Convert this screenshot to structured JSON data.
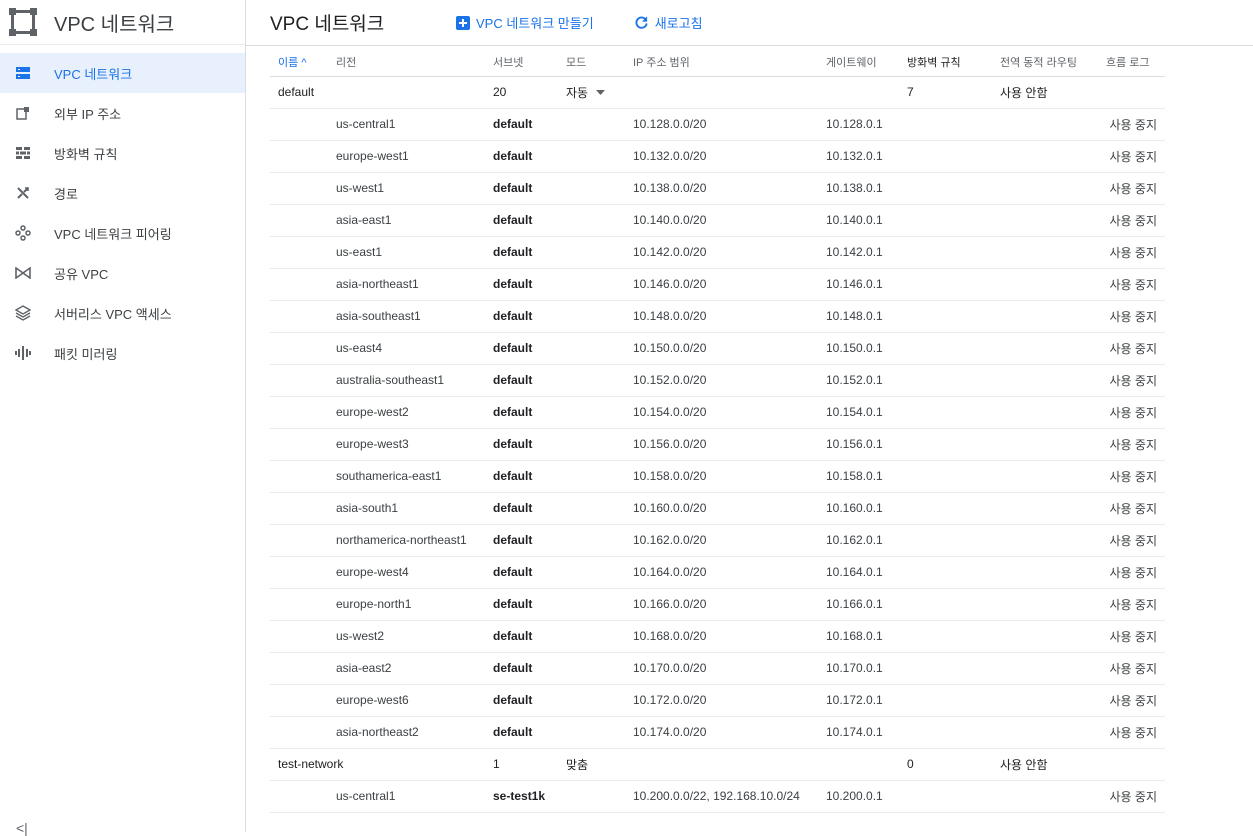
{
  "sidebar": {
    "title": "VPC 네트워크",
    "items": [
      {
        "label": "VPC 네트워크",
        "icon": "vpc-network-icon"
      },
      {
        "label": "외부 IP 주소",
        "icon": "external-ip-icon"
      },
      {
        "label": "방화벽 규칙",
        "icon": "firewall-icon"
      },
      {
        "label": "경로",
        "icon": "routes-icon"
      },
      {
        "label": "VPC 네트워크 피어링",
        "icon": "peering-icon"
      },
      {
        "label": "공유 VPC",
        "icon": "shared-vpc-icon"
      },
      {
        "label": "서버리스 VPC 액세스",
        "icon": "serverless-icon"
      },
      {
        "label": "패킷 미러링",
        "icon": "packet-mirroring-icon"
      }
    ],
    "collapse_label": "<|"
  },
  "header": {
    "title": "VPC 네트워크",
    "create_label": "VPC 네트워크 만들기",
    "refresh_label": "새로고침"
  },
  "table": {
    "columns": {
      "name": "이름",
      "region": "리전",
      "subnets": "서브넷",
      "mode": "모드",
      "ip_range": "IP 주소 범위",
      "gateway": "게이트웨이",
      "firewall": "방화벽 규칙",
      "routing": "전역 동적 라우팅",
      "flow_logs": "흐름 로그"
    },
    "sort_arrow": "^",
    "networks": [
      {
        "name": "default",
        "subnets": "20",
        "mode": "자동",
        "firewall": "7",
        "routing": "사용 안함",
        "rows": [
          {
            "region": "us-central1",
            "subnet": "default",
            "ip": "10.128.0.0/20",
            "gw": "10.128.0.1",
            "flow": "사용 중지"
          },
          {
            "region": "europe-west1",
            "subnet": "default",
            "ip": "10.132.0.0/20",
            "gw": "10.132.0.1",
            "flow": "사용 중지"
          },
          {
            "region": "us-west1",
            "subnet": "default",
            "ip": "10.138.0.0/20",
            "gw": "10.138.0.1",
            "flow": "사용 중지"
          },
          {
            "region": "asia-east1",
            "subnet": "default",
            "ip": "10.140.0.0/20",
            "gw": "10.140.0.1",
            "flow": "사용 중지"
          },
          {
            "region": "us-east1",
            "subnet": "default",
            "ip": "10.142.0.0/20",
            "gw": "10.142.0.1",
            "flow": "사용 중지"
          },
          {
            "region": "asia-northeast1",
            "subnet": "default",
            "ip": "10.146.0.0/20",
            "gw": "10.146.0.1",
            "flow": "사용 중지"
          },
          {
            "region": "asia-southeast1",
            "subnet": "default",
            "ip": "10.148.0.0/20",
            "gw": "10.148.0.1",
            "flow": "사용 중지"
          },
          {
            "region": "us-east4",
            "subnet": "default",
            "ip": "10.150.0.0/20",
            "gw": "10.150.0.1",
            "flow": "사용 중지"
          },
          {
            "region": "australia-southeast1",
            "subnet": "default",
            "ip": "10.152.0.0/20",
            "gw": "10.152.0.1",
            "flow": "사용 중지"
          },
          {
            "region": "europe-west2",
            "subnet": "default",
            "ip": "10.154.0.0/20",
            "gw": "10.154.0.1",
            "flow": "사용 중지"
          },
          {
            "region": "europe-west3",
            "subnet": "default",
            "ip": "10.156.0.0/20",
            "gw": "10.156.0.1",
            "flow": "사용 중지"
          },
          {
            "region": "southamerica-east1",
            "subnet": "default",
            "ip": "10.158.0.0/20",
            "gw": "10.158.0.1",
            "flow": "사용 중지"
          },
          {
            "region": "asia-south1",
            "subnet": "default",
            "ip": "10.160.0.0/20",
            "gw": "10.160.0.1",
            "flow": "사용 중지"
          },
          {
            "region": "northamerica-northeast1",
            "subnet": "default",
            "ip": "10.162.0.0/20",
            "gw": "10.162.0.1",
            "flow": "사용 중지"
          },
          {
            "region": "europe-west4",
            "subnet": "default",
            "ip": "10.164.0.0/20",
            "gw": "10.164.0.1",
            "flow": "사용 중지"
          },
          {
            "region": "europe-north1",
            "subnet": "default",
            "ip": "10.166.0.0/20",
            "gw": "10.166.0.1",
            "flow": "사용 중지"
          },
          {
            "region": "us-west2",
            "subnet": "default",
            "ip": "10.168.0.0/20",
            "gw": "10.168.0.1",
            "flow": "사용 중지"
          },
          {
            "region": "asia-east2",
            "subnet": "default",
            "ip": "10.170.0.0/20",
            "gw": "10.170.0.1",
            "flow": "사용 중지"
          },
          {
            "region": "europe-west6",
            "subnet": "default",
            "ip": "10.172.0.0/20",
            "gw": "10.172.0.1",
            "flow": "사용 중지"
          },
          {
            "region": "asia-northeast2",
            "subnet": "default",
            "ip": "10.174.0.0/20",
            "gw": "10.174.0.1",
            "flow": "사용 중지"
          }
        ]
      },
      {
        "name": "test-network",
        "subnets": "1",
        "mode": "맞춤",
        "firewall": "0",
        "routing": "사용 안함",
        "rows": [
          {
            "region": "us-central1",
            "subnet": "se-test1k",
            "ip": "10.200.0.0/22, 192.168.10.0/24",
            "gw": "10.200.0.1",
            "flow": "사용 중지"
          }
        ]
      }
    ]
  },
  "colors": {
    "accent": "#1a73e8",
    "active_bg": "#e8f0fe"
  }
}
